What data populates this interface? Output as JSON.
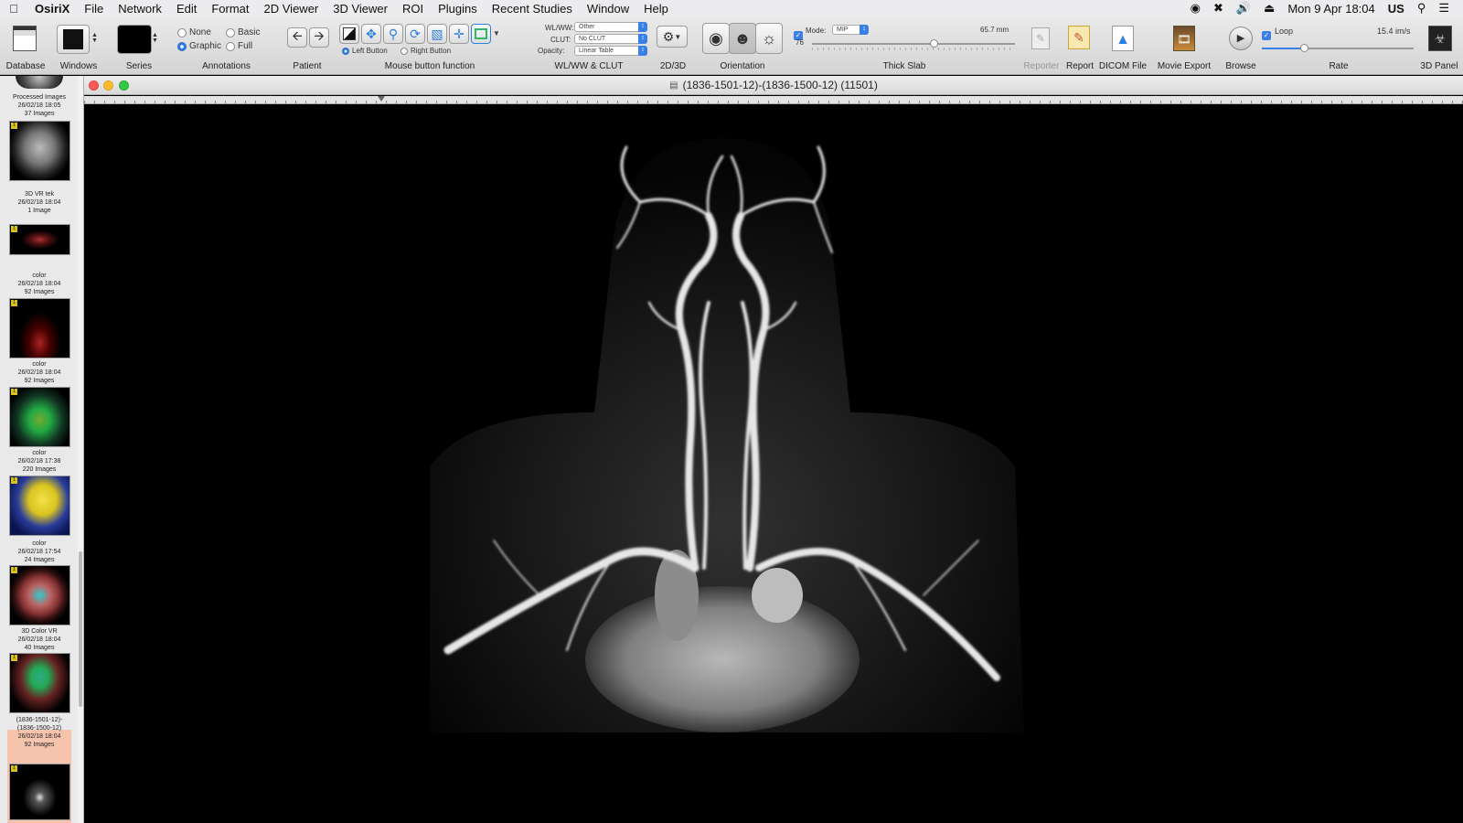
{
  "menubar": {
    "apple_icon": "apple-icon",
    "items": [
      "OsiriX",
      "File",
      "Network",
      "Edit",
      "Format",
      "2D Viewer",
      "3D Viewer",
      "ROI",
      "Plugins",
      "Recent Studies",
      "Window",
      "Help"
    ],
    "clock": "Mon 9 Apr  18:04",
    "input_source": "US"
  },
  "toolbar": {
    "database": "Database",
    "windows": "Windows",
    "series": "Series",
    "annotations": {
      "label": "Annotations",
      "none": "None",
      "basic": "Basic",
      "graphic": "Graphic",
      "full": "Full",
      "selected": "Graphic"
    },
    "patient": "Patient",
    "mouse": {
      "label": "Mouse button function",
      "left": "Left Button",
      "right": "Right Button"
    },
    "wlww": {
      "label": "WL/WW & CLUT",
      "wlww_label": "WL/WW:",
      "wlww_value": "Other",
      "clut_label": "CLUT:",
      "clut_value": "No CLUT",
      "opacity_label": "Opacity:",
      "opacity_value": "Linear Table"
    },
    "twod3d": "2D/3D",
    "orientation": "Orientation",
    "thickslab": {
      "label": "Thick Slab",
      "mode_label": "Mode:",
      "mode_value": "MIP",
      "thickness": "65.7 mm",
      "slices": "76"
    },
    "reporter": "Reporter",
    "report": "Report",
    "dicom_file": "DICOM File",
    "movie_export": "Movie Export",
    "browse": "Browse",
    "rate": {
      "label": "Rate",
      "loop": "Loop",
      "value": "15.4 im/s"
    },
    "panel3d": "3D Panel"
  },
  "sidebar": {
    "series": [
      {
        "name": "Processed Images",
        "date": "26/02/18 18:05",
        "count": "37 Images"
      },
      {
        "name": "3D VR tek",
        "date": "26/02/18 18:04",
        "count": "1 Image"
      },
      {
        "name": "color",
        "date": "26/02/18 18:04",
        "count": "92 Images"
      },
      {
        "name": "color",
        "date": "26/02/18 18:04",
        "count": "92 Images"
      },
      {
        "name": "color",
        "date": "26/02/18 17:38",
        "count": "220 Images"
      },
      {
        "name": "color",
        "date": "26/02/18 17:54",
        "count": "24 Images"
      },
      {
        "name": "3D Color VR",
        "date": "26/02/18 18:04",
        "count": "40 Images"
      },
      {
        "name": "(1836-1501-12)-\n(1836-1500-12)",
        "date": "26/02/18 18:04",
        "count": "92 Images"
      }
    ],
    "badge": "1"
  },
  "viewer": {
    "title": "(1836-1501-12)-(1836-1500-12) (11501)"
  }
}
